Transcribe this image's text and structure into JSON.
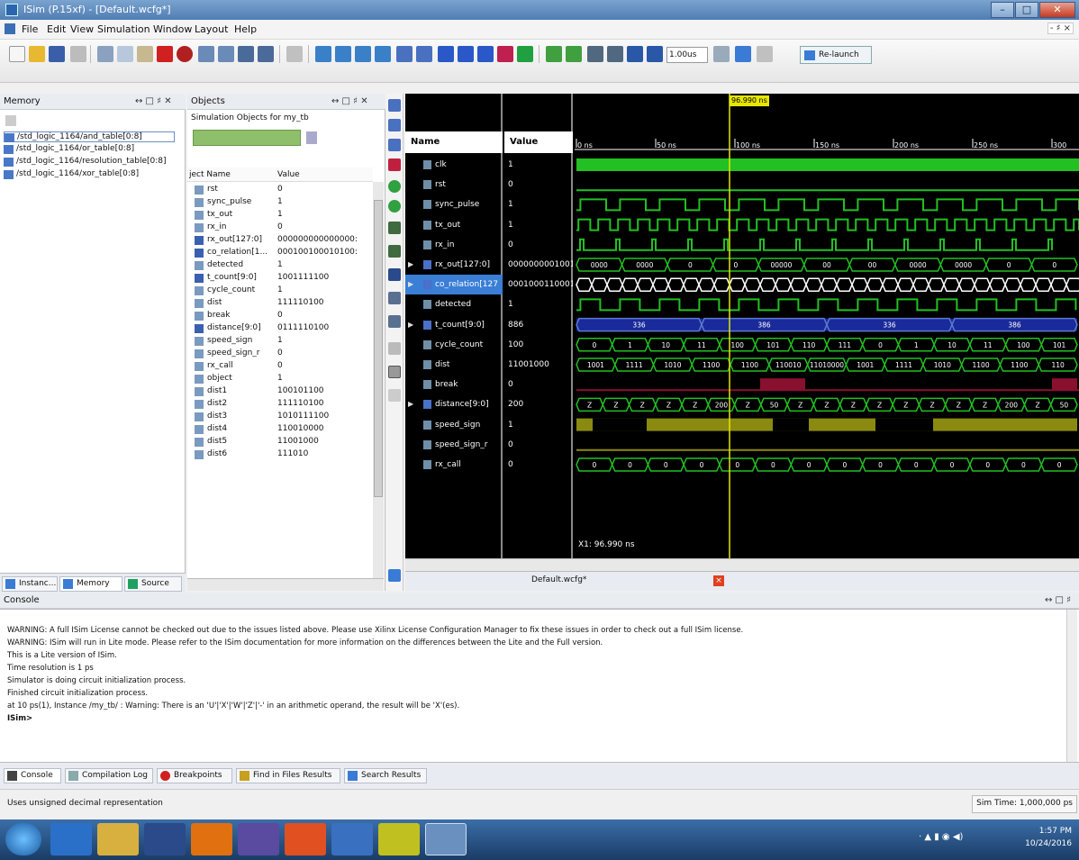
{
  "window": {
    "title": "ISim (P.15xf) - [Default.wcfg*]",
    "controls": [
      "–",
      "□",
      "✕"
    ]
  },
  "menu": {
    "items": [
      "File",
      "Edit",
      "View",
      "Simulation",
      "Window",
      "Layout",
      "Help"
    ],
    "right": "- ♯ ×"
  },
  "toolbar": {
    "time_value": "1.00us",
    "relaunch_label": "Re-launch"
  },
  "memory_pane": {
    "title": "Memory",
    "items": [
      "/std_logic_1164/and_table[0:8]",
      "/std_logic_1164/or_table[0:8]",
      "/std_logic_1164/resolution_table[0:8]",
      "/std_logic_1164/xor_table[0:8]"
    ],
    "tabs": [
      "Instanc...",
      "Memory",
      "Source"
    ]
  },
  "objects_pane": {
    "title": "Objects",
    "subtitle": "Simulation Objects for my_tb",
    "col_name": "ject Name",
    "col_value": "Value",
    "rows": [
      {
        "name": "rst",
        "value": "0"
      },
      {
        "name": "sync_pulse",
        "value": "1"
      },
      {
        "name": "tx_out",
        "value": "1"
      },
      {
        "name": "rx_in",
        "value": "0"
      },
      {
        "name": "rx_out[127:0]",
        "value": "000000000000000:"
      },
      {
        "name": "co_relation[1...",
        "value": "000100100010100:"
      },
      {
        "name": "detected",
        "value": "1"
      },
      {
        "name": "t_count[9:0]",
        "value": "1001111100"
      },
      {
        "name": "cycle_count",
        "value": "1"
      },
      {
        "name": "dist",
        "value": "111110100"
      },
      {
        "name": "break",
        "value": "0"
      },
      {
        "name": "distance[9:0]",
        "value": "0111110100"
      },
      {
        "name": "speed_sign",
        "value": "1"
      },
      {
        "name": "speed_sign_r",
        "value": "0"
      },
      {
        "name": "rx_call",
        "value": "0"
      },
      {
        "name": "object",
        "value": "1"
      },
      {
        "name": "dist1",
        "value": "100101100"
      },
      {
        "name": "dist2",
        "value": "111110100"
      },
      {
        "name": "dist3",
        "value": "1010111100"
      },
      {
        "name": "dist4",
        "value": "110010000"
      },
      {
        "name": "dist5",
        "value": "11001000"
      },
      {
        "name": "dist6",
        "value": "111010"
      }
    ]
  },
  "wave": {
    "cursor_label": "96.990 ns",
    "cursor_readout": "X1: 96.990 ns",
    "tab_label": "Default.wcfg*",
    "col_name": "Name",
    "col_value": "Value",
    "time_ticks": [
      "0 ns",
      "50 ns",
      "100 ns",
      "150 ns",
      "200 ns",
      "250 ns",
      "300"
    ],
    "signals": [
      {
        "name": "clk",
        "value": "1",
        "bus": false
      },
      {
        "name": "rst",
        "value": "0",
        "bus": false
      },
      {
        "name": "sync_pulse",
        "value": "1",
        "bus": false
      },
      {
        "name": "tx_out",
        "value": "1",
        "bus": false
      },
      {
        "name": "rx_in",
        "value": "0",
        "bus": false
      },
      {
        "name": "rx_out[127:0]",
        "value": "0000000001001",
        "bus": true
      },
      {
        "name": "co_relation[127",
        "value": "0001000110001",
        "bus": true
      },
      {
        "name": "detected",
        "value": "1",
        "bus": false
      },
      {
        "name": "t_count[9:0]",
        "value": "886",
        "bus": true
      },
      {
        "name": "cycle_count",
        "value": "100",
        "bus": false
      },
      {
        "name": "dist",
        "value": "11001000",
        "bus": false
      },
      {
        "name": "break",
        "value": "0",
        "bus": false
      },
      {
        "name": "distance[9:0]",
        "value": "200",
        "bus": true
      },
      {
        "name": "speed_sign",
        "value": "1",
        "bus": false
      },
      {
        "name": "speed_sign_r",
        "value": "0",
        "bus": false
      },
      {
        "name": "rx_call",
        "value": "0",
        "bus": false
      }
    ],
    "bus_labels": {
      "rx_out": [
        "0000",
        "0000",
        "0",
        "0",
        "00000",
        "00",
        "00",
        "0000",
        "0000",
        "0",
        "0"
      ],
      "t_count": [
        "336",
        "386",
        "336",
        "386"
      ],
      "cycle_count": [
        "0",
        "1",
        "10",
        "11",
        "100",
        "101",
        "110",
        "111",
        "0",
        "1",
        "10",
        "11",
        "100",
        "101"
      ],
      "dist": [
        "1001",
        "1111",
        "1010",
        "1100",
        "1100",
        "110010",
        "11010000",
        "1001",
        "1111",
        "1010",
        "1100",
        "1100",
        "110"
      ],
      "distance": [
        "Z",
        "Z",
        "Z",
        "Z",
        "Z",
        "200",
        "Z",
        "50",
        "Z",
        "Z",
        "Z",
        "Z",
        "Z",
        "Z",
        "Z",
        "Z",
        "200",
        "Z",
        "50"
      ],
      "rx_call": [
        "0",
        "0",
        "0",
        "0",
        "0",
        "0",
        "0",
        "0",
        "0",
        "0",
        "0",
        "0",
        "0",
        "0"
      ]
    }
  },
  "console": {
    "title": "Console",
    "lines": [
      "WARNING: A full ISim License cannot be checked out due to the issues listed above. Please use Xilinx License Configuration Manager to fix these issues in order to check out a full ISim license.",
      "WARNING: ISim will run in Lite mode. Please refer to the ISim documentation for more information on the differences between the Lite and the Full version.",
      "This is a Lite version of ISim.",
      "Time resolution is 1 ps",
      "Simulator is doing circuit initialization process.",
      "Finished circuit initialization process.",
      "at 10 ps(1), Instance /my_tb/ : Warning: There is an 'U'|'X'|'W'|'Z'|'-' in an arithmetic operand, the result will be 'X'(es).",
      "ISim>"
    ],
    "tabs": [
      "Console",
      "Compilation Log",
      "Breakpoints",
      "Find in Files Results",
      "Search Results"
    ]
  },
  "status": {
    "left": "Uses unsigned decimal representation",
    "right": "Sim Time: 1,000,000 ps"
  },
  "taskbar": {
    "time": "1:57 PM",
    "date": "10/24/2016"
  },
  "colors": {
    "wave_green": "#22c022",
    "bus_blue": "#1a2a9a",
    "cursor": "#e6e600",
    "break_red": "#8a1030",
    "sign_olive": "#8a8a10"
  }
}
